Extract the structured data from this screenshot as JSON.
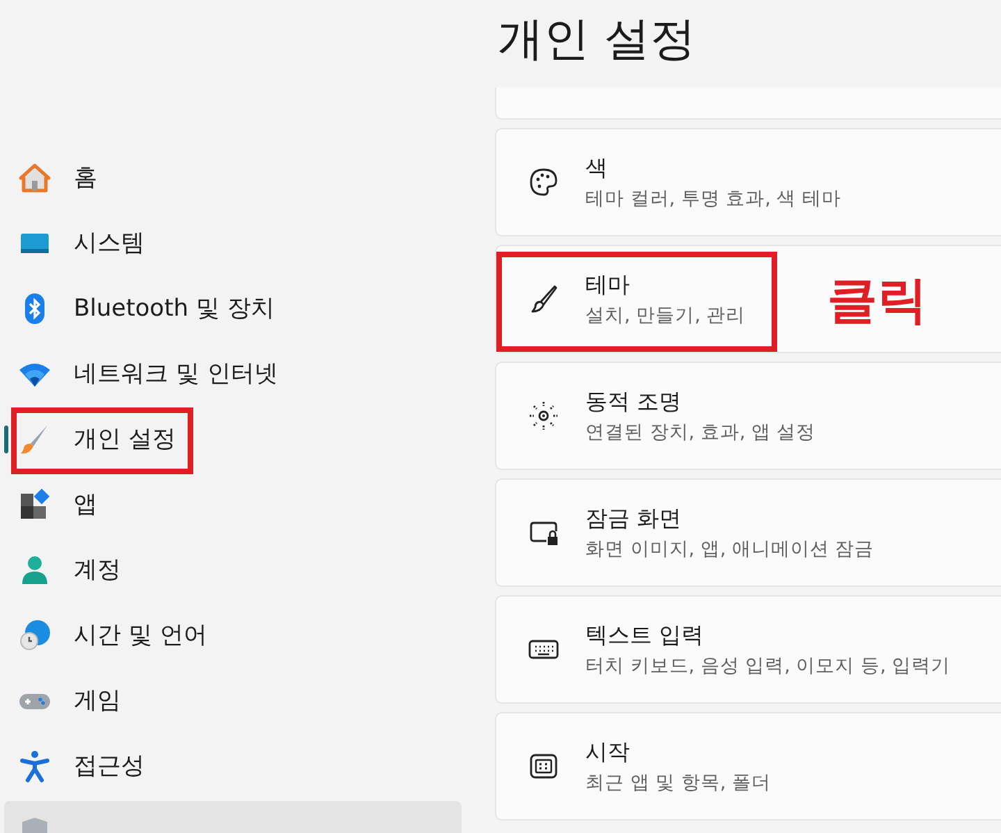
{
  "page_title": "개인 설정",
  "sidebar": {
    "items": [
      {
        "kind": "home",
        "label": "홈",
        "selected": false,
        "hovered": false
      },
      {
        "kind": "system",
        "label": "시스템",
        "selected": false,
        "hovered": false
      },
      {
        "kind": "bluetooth",
        "label": "Bluetooth 및 장치",
        "selected": false,
        "hovered": false
      },
      {
        "kind": "network",
        "label": "네트워크 및 인터넷",
        "selected": false,
        "hovered": false
      },
      {
        "kind": "personalize",
        "label": "개인 설정",
        "selected": true,
        "hovered": false,
        "annotated": true
      },
      {
        "kind": "apps",
        "label": "앱",
        "selected": false,
        "hovered": false
      },
      {
        "kind": "account",
        "label": "계정",
        "selected": false,
        "hovered": false
      },
      {
        "kind": "time",
        "label": "시간 및 언어",
        "selected": false,
        "hovered": false
      },
      {
        "kind": "gaming",
        "label": "게임",
        "selected": false,
        "hovered": false
      },
      {
        "kind": "accessibility",
        "label": "접근성",
        "selected": false,
        "hovered": false
      },
      {
        "kind": "privacy",
        "selected": false,
        "hovered": true
      }
    ]
  },
  "cards": [
    {
      "kind": "cut"
    },
    {
      "kind": "palette",
      "title": "색",
      "subtitle": "테마 컬러, 투명 효과, 색 테마"
    },
    {
      "kind": "brush",
      "title": "테마",
      "subtitle": "설치, 만들기, 관리",
      "annotated": true,
      "annotation": "클릭"
    },
    {
      "kind": "lighting",
      "title": "동적 조명",
      "subtitle": "연결된 장치, 효과, 앱 설정"
    },
    {
      "kind": "lock",
      "title": "잠금 화면",
      "subtitle": "화면 이미지, 앱, 애니메이션 잠금"
    },
    {
      "kind": "keyboard",
      "title": "텍스트 입력",
      "subtitle": "터치 키보드, 음성 입력, 이모지 등, 입력기"
    },
    {
      "kind": "start",
      "title": "시작",
      "subtitle": "최근 앱 및 항목, 폴더"
    }
  ]
}
